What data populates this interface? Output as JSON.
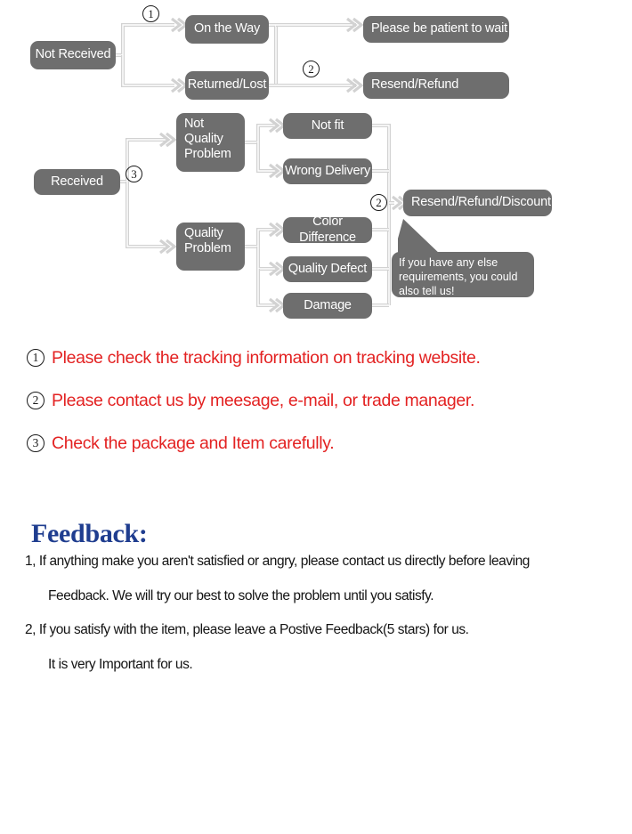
{
  "flowchart": {
    "nodes": {
      "not_received": "Not Received",
      "on_the_way": "On the Way",
      "returned_lost": "Returned/Lost",
      "please_wait": "Please be patient to wait",
      "resend_refund": "Resend/Refund",
      "received": "Received",
      "not_quality_problem": "Not\nQuality\nProblem",
      "quality_problem": "Quality\nProblem",
      "not_fit": "Not fit",
      "wrong_delivery": "Wrong Delivery",
      "color_difference": "Color Difference",
      "quality_defect": "Quality Defect",
      "damage": "Damage",
      "resend_refund_discount": "Resend/Refund/Discount"
    },
    "markers": {
      "one_top": "1",
      "two_top": "2",
      "three_left": "3",
      "two_right": "2"
    },
    "callout": "If you have any else\nrequirements, you could\nalso tell us!",
    "colors": {
      "node_fill": "#6e6e6e",
      "node_text": "#ffffff",
      "connector": "#d2d2d2"
    }
  },
  "notes": [
    {
      "number": "1",
      "text": "Please check the tracking information on tracking website."
    },
    {
      "number": "2",
      "text": "Please contact us by meesage, e-mail, or trade manager."
    },
    {
      "number": "3",
      "text": "Check the package and Item carefully."
    }
  ],
  "feedback": {
    "title": "Feedback:",
    "title_color": "#1f3d8f",
    "lines": [
      {
        "text": "1, If anything make you aren't satisfied or angry, please contact us directly before leaving",
        "indent": false
      },
      {
        "text": "Feedback. We will try our best to solve the problem until you satisfy.",
        "indent": true
      },
      {
        "text": "2, If you satisfy with the item, please leave a Postive Feedback(5 stars) for us.",
        "indent": false
      },
      {
        "text": "It is very Important for us.",
        "indent": true
      }
    ]
  }
}
